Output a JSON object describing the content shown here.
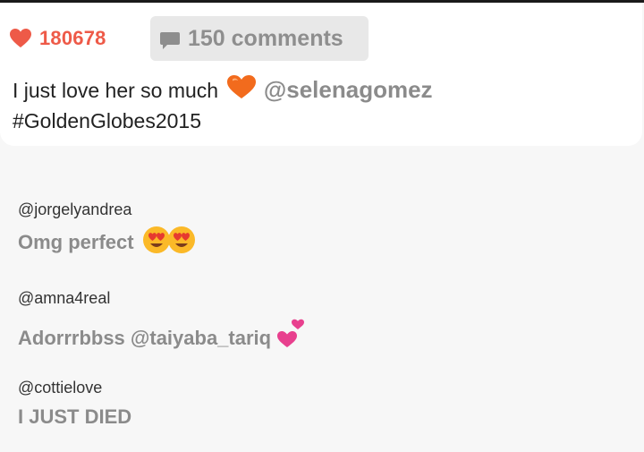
{
  "post": {
    "likes": "180678",
    "comments_label": "150 comments",
    "caption_text": "I just love her so much",
    "caption_mention": "@selenagomez",
    "caption_hashtag": "#GoldenGlobes2015"
  },
  "comments": [
    {
      "user": "@jorgelyandrea",
      "text": "Omg perfect",
      "emoji": [
        "heart-eyes-emoji",
        "heart-eyes-emoji"
      ]
    },
    {
      "user": "@amna4real",
      "text": "Adorrrbbss @taiyaba_tariq",
      "emoji": [
        "pink-hearts-emoji"
      ]
    },
    {
      "user": "@cottielove",
      "text": "I JUST DIED"
    }
  ],
  "colors": {
    "like": "#ee5a48",
    "muted": "#8b8b8b",
    "heart": "#f26b1d",
    "pink": "#e8408e"
  }
}
